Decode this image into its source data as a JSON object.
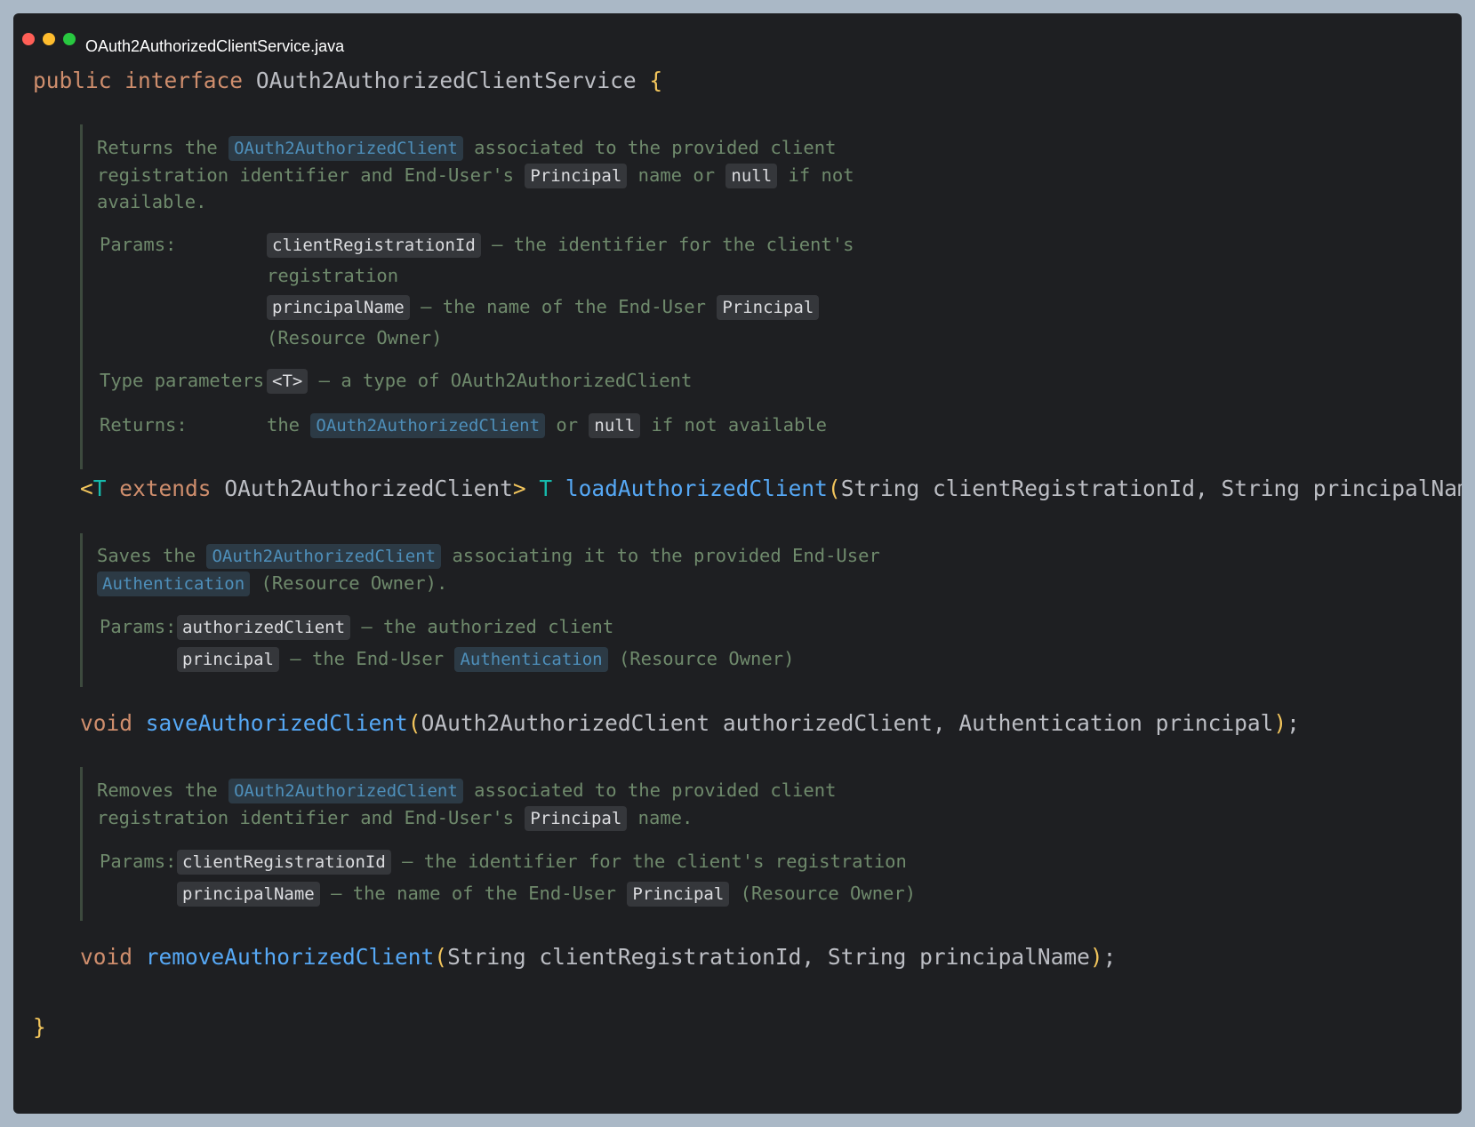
{
  "window": {
    "title": "OAuth2AuthorizedClientService.java"
  },
  "code": {
    "line1": {
      "kw_public": "public",
      "kw_interface": "interface",
      "name": "OAuth2AuthorizedClientService",
      "open_brace": "{"
    },
    "load": {
      "doc": {
        "l1_a": "Returns the",
        "l1_link": "OAuth2AuthorizedClient",
        "l1_b": "associated to the provided client",
        "l2_a": "registration identifier and End-User's",
        "l2_chip1": "Principal",
        "l2_b": "name or",
        "l2_chip2": "null",
        "l2_c": "if not",
        "l3": "available.",
        "params_label": "Params:",
        "p1_chip": "clientRegistrationId",
        "p1_a": "– the identifier for the client's",
        "p1_b": "registration",
        "p2_chip": "principalName",
        "p2_a": "– the name of the End-User",
        "p2_chip2": "Principal",
        "p2_b": "(Resource Owner)",
        "tp_label": "Type parameters:",
        "tp_chip": "<T>",
        "tp_text": "– a type of OAuth2AuthorizedClient",
        "ret_label": "Returns:",
        "ret_a": "the",
        "ret_link": "OAuth2AuthorizedClient",
        "ret_b": "or",
        "ret_chip": "null",
        "ret_c": "if not available"
      },
      "sig": {
        "lt": "<",
        "t1": "T",
        "kw_extends": "extends",
        "bound": "OAuth2AuthorizedClient",
        "gt": ">",
        "t2": "T",
        "method": "loadAuthorizedClient",
        "lparen": "(",
        "args": "String clientRegistrationId, String principalName",
        "rparen": ")",
        "semi": ";"
      }
    },
    "save": {
      "doc": {
        "l1_a": "Saves the",
        "l1_link": "OAuth2AuthorizedClient",
        "l1_b": "associating it to the provided End-User",
        "l2_link": "Authentication",
        "l2_b": "(Resource Owner).",
        "params_label": "Params:",
        "p1_chip": "authorizedClient",
        "p1_a": "– the authorized client",
        "p2_chip": "principal",
        "p2_a": "– the End-User",
        "p2_link": "Authentication",
        "p2_b": "(Resource Owner)"
      },
      "sig": {
        "kw_void": "void",
        "method": "saveAuthorizedClient",
        "lparen": "(",
        "args": "OAuth2AuthorizedClient authorizedClient, Authentication principal",
        "rparen": ")",
        "semi": ";"
      }
    },
    "remove": {
      "doc": {
        "l1_a": "Removes the",
        "l1_link": "OAuth2AuthorizedClient",
        "l1_b": "associated to the provided client",
        "l2_a": "registration identifier and End-User's",
        "l2_chip": "Principal",
        "l2_b": "name.",
        "params_label": "Params:",
        "p1_chip": "clientRegistrationId",
        "p1_a": "– the identifier for the client's registration",
        "p2_chip": "principalName",
        "p2_a": "– the name of the End-User",
        "p2_chip2": "Principal",
        "p2_b": "(Resource Owner)"
      },
      "sig": {
        "kw_void": "void",
        "method": "removeAuthorizedClient",
        "lparen": "(",
        "args": "String clientRegistrationId, String principalName",
        "rparen": ")",
        "semi": ";"
      }
    },
    "close_brace": "}"
  },
  "colors": {
    "background": "#1e1f22",
    "keyword": "#cf8e6d",
    "method": "#56a8f5",
    "brace": "#f2c55c",
    "type_param": "#16baac",
    "doc_text": "#6f8a6c",
    "doc_link": "#4e8fba"
  }
}
